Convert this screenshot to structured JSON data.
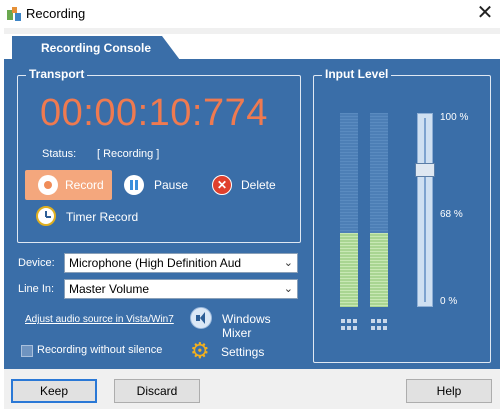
{
  "window": {
    "title": "Recording"
  },
  "tab": {
    "label": "Recording Console"
  },
  "transport": {
    "title": "Transport",
    "timer": "00:00:10:774",
    "status_label": "Status:",
    "status_value": "[ Recording ]",
    "record_label": "Record",
    "pause_label": "Pause",
    "delete_label": "Delete",
    "timer_record_label": "Timer Record"
  },
  "device": {
    "label": "Device:",
    "value": "Microphone (High Definition Aud"
  },
  "line_in": {
    "label": "Line In:",
    "value": "Master Volume"
  },
  "links": {
    "adjust_audio": "Adjust audio source in Vista/Win7",
    "windows_mixer": "Windows Mixer",
    "settings": "Settings"
  },
  "options": {
    "without_silence_label": "Recording without silence",
    "without_silence_checked": false
  },
  "input_level": {
    "title": "Input Level",
    "pct_100": "100 %",
    "pct_68": "68 %",
    "pct_0": "0 %",
    "left_meter_level": 0.38,
    "right_meter_level": 0.38,
    "slider_level": 0.72
  },
  "buttons": {
    "keep": "Keep",
    "discard": "Discard",
    "help": "Help"
  },
  "colors": {
    "panel": "#3a6ea8",
    "timer": "#ef7a50",
    "record_button": "#f4a77d",
    "meter_green": "#b6dda0"
  },
  "icons": {
    "app": "app-icon",
    "close": "close-icon",
    "record": "record-icon",
    "pause": "pause-icon",
    "delete": "delete-icon",
    "timer_record": "clock-icon",
    "mixer": "speaker-icon",
    "settings": "gear-icon"
  }
}
